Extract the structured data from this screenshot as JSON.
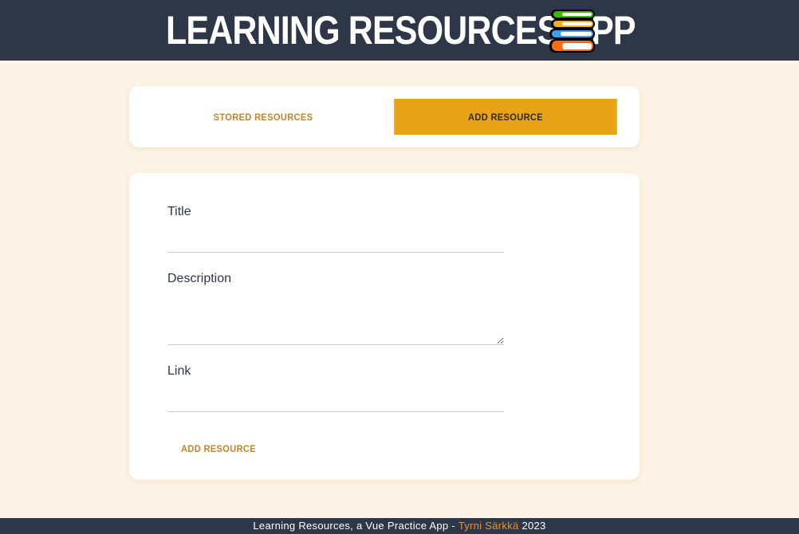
{
  "header": {
    "title": "LEARNING RESOURCES APP",
    "icon": "stacked-books-icon",
    "icon_colors": [
      "#3bb800",
      "#f0b020",
      "#3aa0ff",
      "#ff6a13"
    ]
  },
  "tabs": [
    {
      "label": "STORED RESOURCES",
      "active": false
    },
    {
      "label": "ADD RESOURCE",
      "active": true
    }
  ],
  "form": {
    "title_label": "Title",
    "title_value": "",
    "description_label": "Description",
    "description_value": "",
    "link_label": "Link",
    "link_value": "",
    "submit_label": "ADD RESOURCE"
  },
  "footer": {
    "text": "Learning Resources, a Vue Practice App - ",
    "author": "Tyrni Särkkä",
    "year": " 2023"
  },
  "colors": {
    "header_bg": "#2e3747",
    "page_bg": "#fdf4e7",
    "accent": "#e8a317",
    "link_text": "#c0852a",
    "author_link": "#e8902c"
  }
}
